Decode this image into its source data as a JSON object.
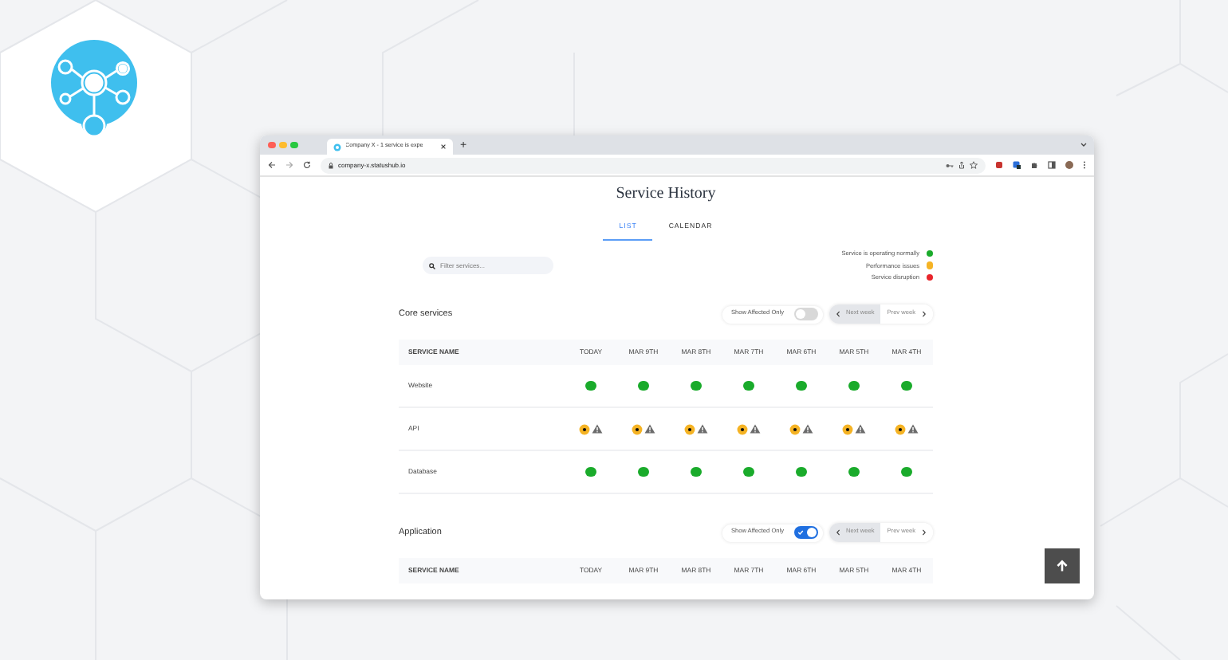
{
  "browser": {
    "tab_title": "Company X - 1 service is expe",
    "new_tab": "+",
    "url": "company-x.statushub.io"
  },
  "page": {
    "title": "Service History",
    "tabs": [
      {
        "label": "LIST",
        "selected": true
      },
      {
        "label": "CALENDAR",
        "selected": false
      }
    ],
    "search": {
      "placeholder": "Filter services..."
    },
    "legend": [
      {
        "label": "Service is operating normally",
        "color": "#1aab2b"
      },
      {
        "label": "Performance issues",
        "color": "#f5b324"
      },
      {
        "label": "Service disruption",
        "color": "#e8252b"
      }
    ],
    "sections": [
      {
        "title": "Core services",
        "toggle_label": "Show Affected Only",
        "show_affected_only": false,
        "next_label": "Next week",
        "prev_label": "Prev week",
        "columns": [
          "SERVICE NAME",
          "TODAY",
          "MAR 9TH",
          "MAR 8TH",
          "MAR 7TH",
          "MAR 6TH",
          "MAR 5TH",
          "MAR 4TH"
        ],
        "rows": [
          {
            "name": "Website",
            "cells": [
              {
                "kind": "normal"
              },
              {
                "kind": "normal"
              },
              {
                "kind": "normal"
              },
              {
                "kind": "normal"
              },
              {
                "kind": "normal"
              },
              {
                "kind": "normal"
              },
              {
                "kind": "normal"
              }
            ]
          },
          {
            "name": "API",
            "cells": [
              {
                "kind": "performance"
              },
              {
                "kind": "performance"
              },
              {
                "kind": "performance"
              },
              {
                "kind": "performance"
              },
              {
                "kind": "performance"
              },
              {
                "kind": "performance"
              },
              {
                "kind": "performance"
              }
            ]
          },
          {
            "name": "Database",
            "cells": [
              {
                "kind": "normal"
              },
              {
                "kind": "normal"
              },
              {
                "kind": "normal"
              },
              {
                "kind": "normal"
              },
              {
                "kind": "normal"
              },
              {
                "kind": "normal"
              },
              {
                "kind": "normal"
              }
            ]
          }
        ]
      },
      {
        "title": "Application",
        "toggle_label": "Show Affected Only",
        "show_affected_only": true,
        "next_label": "Next week",
        "prev_label": "Prev week",
        "columns": [
          "SERVICE NAME",
          "TODAY",
          "MAR 9TH",
          "MAR 8TH",
          "MAR 7TH",
          "MAR 6TH",
          "MAR 5TH",
          "MAR 4TH"
        ]
      }
    ]
  }
}
